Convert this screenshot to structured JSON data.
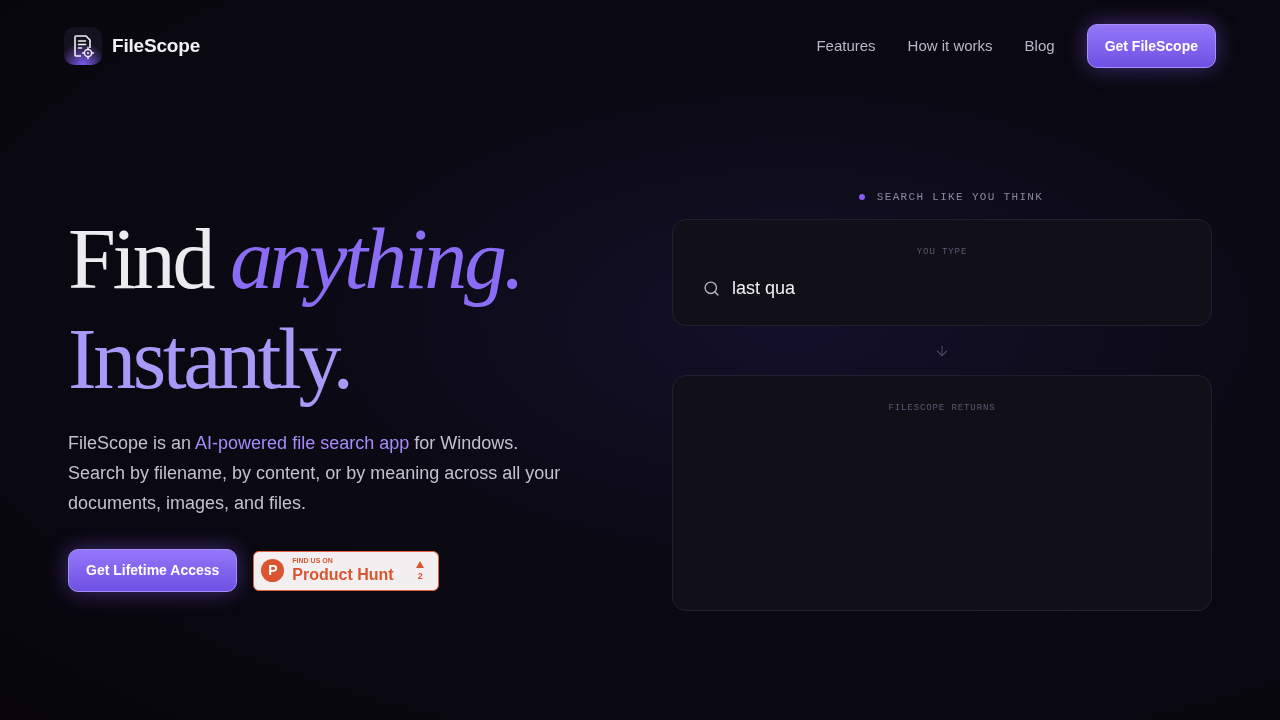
{
  "header": {
    "brand": "FileScope",
    "nav": [
      {
        "label": "Features"
      },
      {
        "label": "How it works"
      },
      {
        "label": "Blog"
      }
    ],
    "cta": "Get FileScope"
  },
  "hero": {
    "heading": [
      "Find *anything.*",
      "Instantly."
    ],
    "description": [
      [
        {
          "text": "FileScope is an ",
          "highlight": false
        },
        {
          "text": "AI-powered file search app",
          "highlight": true
        },
        {
          "text": " for Windows.",
          "highlight": false
        }
      ],
      [
        {
          "text": "Search by filename, by content, or by meaning across all your documents, images, and files.",
          "highlight": false
        }
      ]
    ],
    "primary_button": "Get Lifetime Access",
    "product_hunt": {
      "logo_letter": "P",
      "eyebrow": "FIND US ON",
      "name": "Product Hunt",
      "votes": "2"
    }
  },
  "demo": {
    "eyebrow": "SEARCH LIKE YOU THINK",
    "input_card": {
      "label": "YOU TYPE",
      "value": "last qua"
    },
    "output_card": {
      "label": "FILESCOPE RETURNS"
    }
  }
}
